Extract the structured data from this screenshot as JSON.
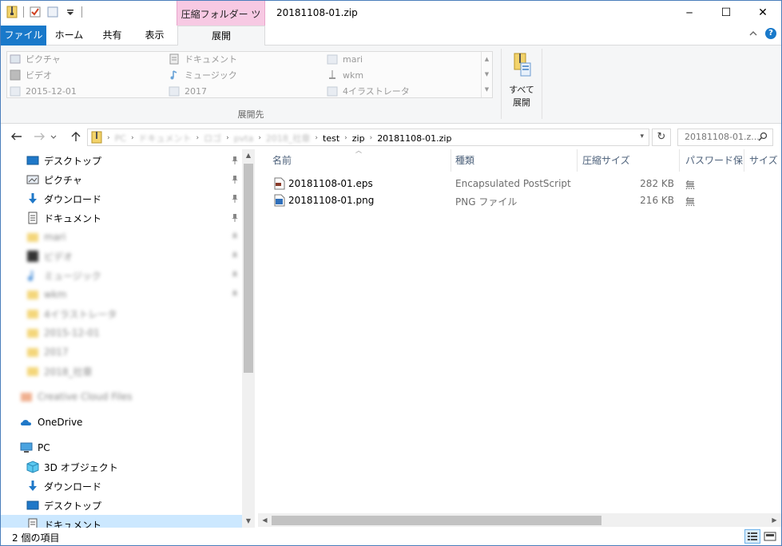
{
  "titlebar": {
    "context_tab": "圧縮フォルダー ツール",
    "window_title": "20181108-01.zip",
    "minimize": "─",
    "maximize": "☐",
    "close": "✕"
  },
  "ribbon_tabs": {
    "file": "ファイル",
    "home": "ホーム",
    "share": "共有",
    "view": "表示",
    "extract": "展開"
  },
  "ribbon": {
    "gallery": [
      {
        "label": "ピクチャ",
        "icon": "pictures-icon"
      },
      {
        "label": "ビデオ",
        "icon": "videos-icon"
      },
      {
        "label": "2015-12-01",
        "icon": "folder-icon"
      },
      {
        "label": "ドキュメント",
        "icon": "documents-icon"
      },
      {
        "label": "ミュージック",
        "icon": "music-icon"
      },
      {
        "label": "2017",
        "icon": "folder-icon"
      },
      {
        "label": "mari",
        "icon": "folder-icon"
      },
      {
        "label": "wkm",
        "icon": "folder-icon"
      },
      {
        "label": "4イラストレータ",
        "icon": "folder-icon"
      }
    ],
    "group_label": "展開先",
    "extract_all_line1": "すべて",
    "extract_all_line2": "展開"
  },
  "address": {
    "blurred_crumbs": [
      "PC",
      "ドキュメント",
      "ロゴ",
      "pvta",
      "2018_社章"
    ],
    "crumbs": [
      "test",
      "zip",
      "20181108-01.zip"
    ],
    "search_placeholder": "20181108-01.z..."
  },
  "nav": {
    "quick_access": [
      {
        "label": "デスクトップ",
        "icon": "desktop-icon",
        "pinned": true
      },
      {
        "label": "ピクチャ",
        "icon": "pictures-icon",
        "pinned": true
      },
      {
        "label": "ダウンロード",
        "icon": "download-icon",
        "pinned": true
      },
      {
        "label": "ドキュメント",
        "icon": "documents-icon",
        "pinned": true
      }
    ],
    "blurred_items": [
      "mari",
      "ビデオ",
      "ミュージック",
      "wkm",
      "4イラストレータ",
      "2015-12-01",
      "2017",
      "2018_社章",
      "Creative Cloud Files"
    ],
    "onedrive": "OneDrive",
    "pc": "PC",
    "pc_items": [
      {
        "label": "3D オブジェクト",
        "icon": "3d-objects-icon"
      },
      {
        "label": "ダウンロード",
        "icon": "download-icon"
      },
      {
        "label": "デスクトップ",
        "icon": "desktop-icon"
      },
      {
        "label": "ドキュメント",
        "icon": "documents-icon"
      }
    ]
  },
  "columns": {
    "name": "名前",
    "type": "種類",
    "compressed_size": "圧縮サイズ",
    "password": "パスワード保...",
    "size": "サイズ"
  },
  "files": [
    {
      "name": "20181108-01.eps",
      "type": "Encapsulated PostScript",
      "size": "282 KB",
      "password": "無",
      "icon": "eps-file-icon"
    },
    {
      "name": "20181108-01.png",
      "type": "PNG ファイル",
      "size": "216 KB",
      "password": "無",
      "icon": "png-file-icon"
    }
  ],
  "status": {
    "item_count": "2 個の項目"
  },
  "colors": {
    "accent": "#1979ca",
    "context_tab": "#f7c9e3",
    "selection": "#cce8ff"
  }
}
